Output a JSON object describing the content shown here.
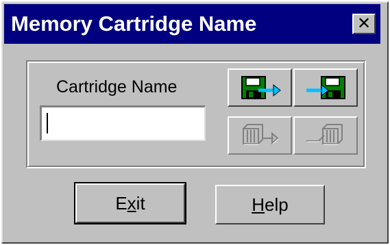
{
  "window": {
    "title": "Memory Cartridge Name",
    "close_glyph": "✕",
    "title_bar_color": "#000080",
    "face_color": "#c0c0c0"
  },
  "cartridge": {
    "label": "Cartridge Name",
    "value": "",
    "placeholder": ""
  },
  "toolbar": {
    "buttons": [
      {
        "icon": "save-to-cartridge-icon",
        "enabled": true
      },
      {
        "icon": "load-from-cartridge-icon",
        "enabled": true
      },
      {
        "icon": "export-cartridge-icon",
        "enabled": false
      },
      {
        "icon": "import-cartridge-icon",
        "enabled": false
      }
    ],
    "icon_colors": {
      "floppy": "#008000",
      "arrow": "#00c0ff",
      "disabled": "#808080"
    }
  },
  "actions": {
    "exit": {
      "mnemonic_pre": "E",
      "mnemonic": "x",
      "mnemonic_post": "it"
    },
    "help": {
      "mnemonic_pre": "",
      "mnemonic": "H",
      "mnemonic_post": "elp"
    }
  }
}
